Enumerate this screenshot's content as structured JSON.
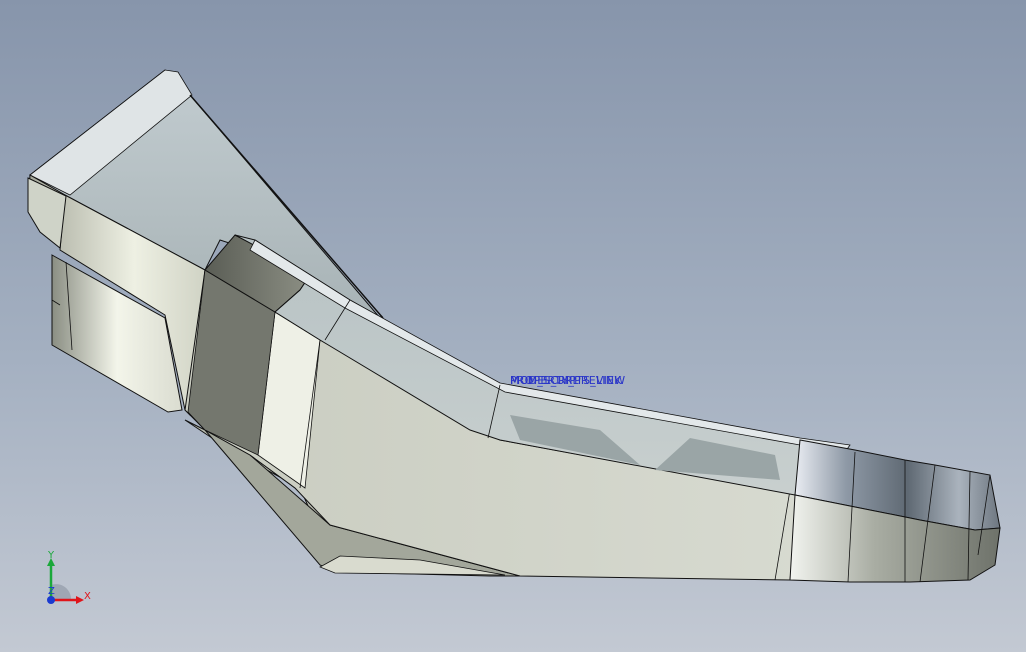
{
  "annotations": {
    "labels": [
      "MCM_SCRIPTS_LINK",
      "PROPERTY_PREVIEW",
      "MODEL_URL"
    ]
  },
  "triad": {
    "x_label": "X",
    "y_label": "Y",
    "z_label": "Z"
  },
  "colors": {
    "annotation": "#2a35c8",
    "axis_x": "#e0141a",
    "axis_y": "#1aa83a",
    "axis_z": "#1a3ad0",
    "edge": "#111111"
  }
}
